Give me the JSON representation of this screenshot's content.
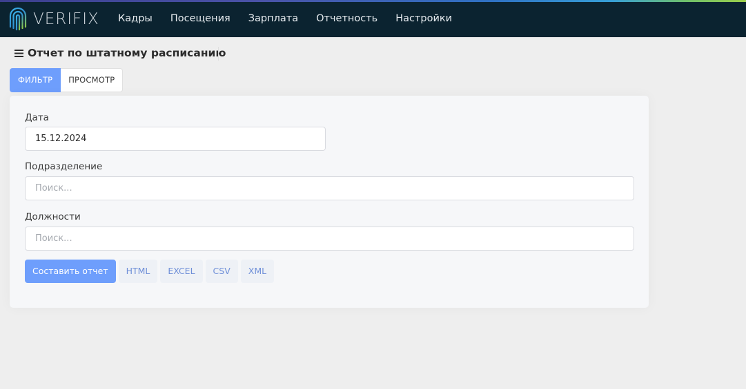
{
  "app": {
    "brand": "VERIFIX",
    "colors": {
      "topbar": "#0b2330",
      "accent": "#6e9efc",
      "background": "#eeeeee"
    }
  },
  "nav": {
    "items": [
      {
        "label": "Кадры"
      },
      {
        "label": "Посещения"
      },
      {
        "label": "Зарплата"
      },
      {
        "label": "Отчетность"
      },
      {
        "label": "Настройки"
      }
    ]
  },
  "page": {
    "title": "Отчет по штатному расписанию",
    "menu_icon": "hamburger-menu-icon"
  },
  "tabs": [
    {
      "label": "Фильтр",
      "active": true
    },
    {
      "label": "Просмотр",
      "active": false
    }
  ],
  "form": {
    "date": {
      "label": "Дата",
      "value": "15.12.2024"
    },
    "division": {
      "label": "Подразделение",
      "placeholder": "Поиск..."
    },
    "positions": {
      "label": "Должности",
      "placeholder": "Поиск..."
    }
  },
  "actions": {
    "generate": "Составить отчет",
    "html": "HTML",
    "excel": "EXCEL",
    "csv": "CSV",
    "xml": "XML"
  }
}
